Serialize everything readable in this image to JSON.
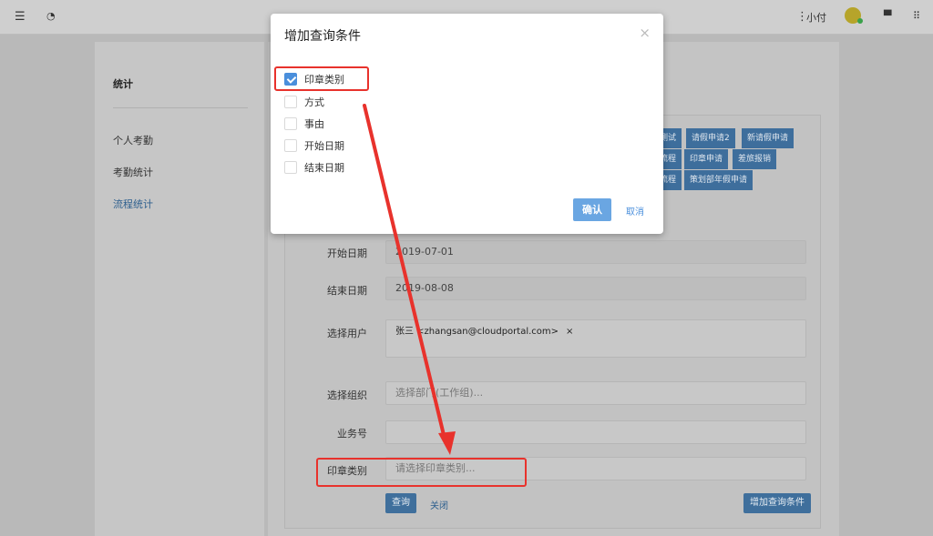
{
  "header": {
    "user_label": "小付"
  },
  "sidebar": {
    "title": "统计",
    "items": [
      {
        "label": "个人考勤"
      },
      {
        "label": "考勤统计"
      },
      {
        "label": "流程统计"
      }
    ]
  },
  "chips": {
    "row1": [
      "测试",
      "请假申请2",
      "新请假申请"
    ],
    "row2": [
      "流程",
      "印章申请",
      "差旅报销"
    ],
    "row3": [
      "流程",
      "策划部年假申请"
    ]
  },
  "form": {
    "start_date": {
      "label": "开始日期",
      "value": "2019-07-01"
    },
    "end_date": {
      "label": "结束日期",
      "value": "2019-08-08"
    },
    "user": {
      "label": "选择用户",
      "tag": "张三 <zhangsan@cloudportal.com>",
      "remove": "×"
    },
    "org": {
      "label": "选择组织",
      "placeholder": "选择部门(工作组)..."
    },
    "biz_no": {
      "label": "业务号",
      "value": ""
    },
    "seal_type": {
      "label": "印章类别",
      "placeholder": "请选择印章类别..."
    },
    "query_button": "查询",
    "close_link": "关闭",
    "add_condition_button": "增加查询条件"
  },
  "modal": {
    "title": "增加查询条件",
    "close": "×",
    "options": [
      {
        "label": "印章类别",
        "checked": true
      },
      {
        "label": "方式",
        "checked": false
      },
      {
        "label": "事由",
        "checked": false
      },
      {
        "label": "开始日期",
        "checked": false
      },
      {
        "label": "结束日期",
        "checked": false
      }
    ],
    "ok_button": "确认",
    "cancel_link": "取消"
  },
  "annotation_color": "#e8322c"
}
